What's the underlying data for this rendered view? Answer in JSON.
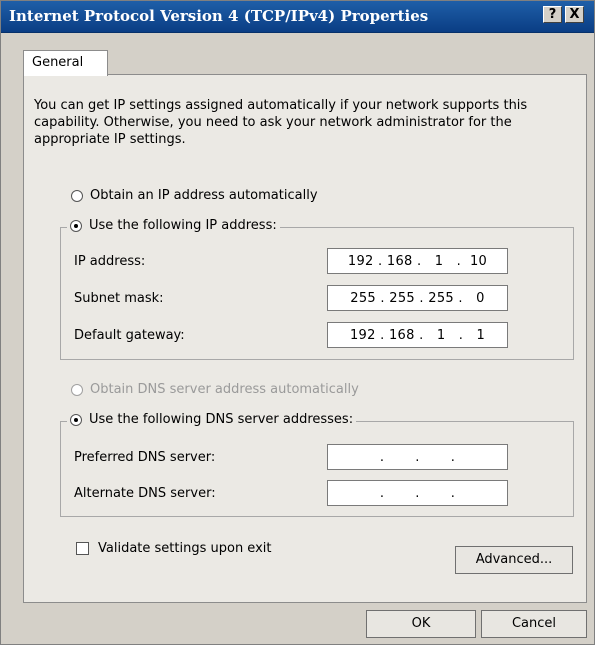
{
  "window": {
    "title": "Internet Protocol Version 4 (TCP/IPv4) Properties",
    "help_button": "?",
    "close_button": "X"
  },
  "tabs": [
    {
      "label": "General"
    }
  ],
  "description": "You can get IP settings assigned automatically if your network supports this capability. Otherwise, you need to ask your network administrator for the appropriate IP settings.",
  "ip_section": {
    "auto_option": "Obtain an IP address automatically",
    "auto_selected": false,
    "manual_option": "Use the following IP address:",
    "manual_selected": true,
    "fields": [
      {
        "label": "IP address:",
        "value": "192 . 168 .   1   .  10"
      },
      {
        "label": "Subnet mask:",
        "value": "255 . 255 . 255 .   0"
      },
      {
        "label": "Default gateway:",
        "value": "192 . 168 .   1   .   1"
      }
    ]
  },
  "dns_section": {
    "auto_option": "Obtain DNS server address automatically",
    "auto_enabled": false,
    "manual_option": "Use the following DNS server addresses:",
    "manual_selected": true,
    "fields": [
      {
        "label": "Preferred DNS server:",
        "value": ".       .       ."
      },
      {
        "label": "Alternate DNS server:",
        "value": ".       .       ."
      }
    ]
  },
  "validate": {
    "label": "Validate settings upon exit",
    "checked": false
  },
  "buttons": {
    "advanced": "Advanced...",
    "ok": "OK",
    "cancel": "Cancel"
  }
}
